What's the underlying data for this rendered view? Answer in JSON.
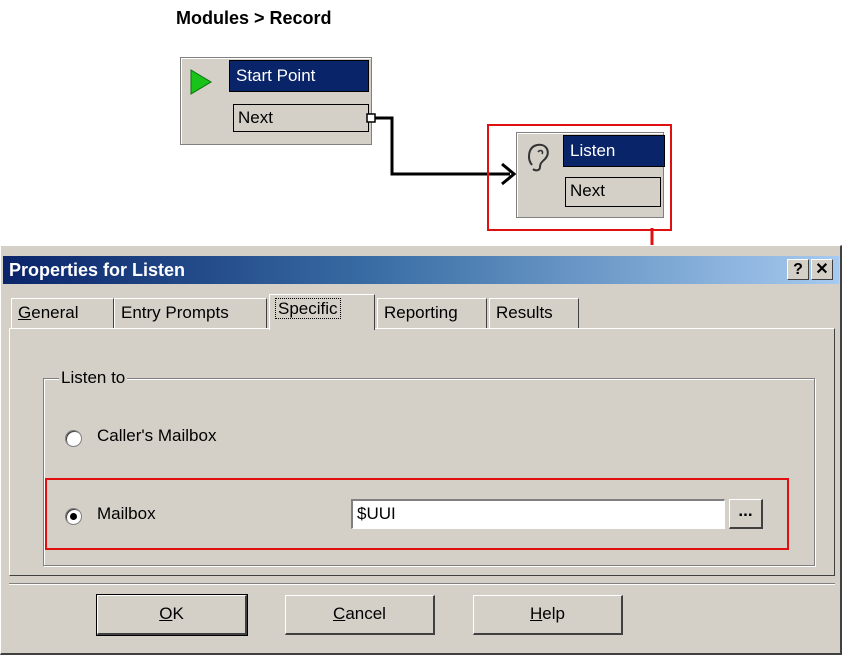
{
  "breadcrumb": "Modules > Record",
  "flow": {
    "start": {
      "title": "Start Point",
      "port": "Next"
    },
    "listen": {
      "title": "Listen",
      "port": "Next"
    }
  },
  "dialog": {
    "title": "Properties for Listen",
    "help_button": "?",
    "close_button": "✕",
    "tabs": [
      {
        "label": "General",
        "underline": "G",
        "rest": "eneral"
      },
      {
        "label": "Entry Prompts"
      },
      {
        "label": "Specific"
      },
      {
        "label": "Reporting"
      },
      {
        "label": "Results"
      }
    ],
    "active_tab": "Specific",
    "group_label": "Listen to",
    "radio_callers_mailbox": "Caller's Mailbox",
    "radio_mailbox": "Mailbox",
    "selected_radio": "Mailbox",
    "mailbox_value": "$UUI",
    "browse_button": "...",
    "ok": {
      "u": "O",
      "rest": "K"
    },
    "cancel": {
      "u": "C",
      "rest": "ancel"
    },
    "help": {
      "u": "H",
      "rest": "elp"
    }
  },
  "colors": {
    "highlight_red": "#e01010",
    "title_blue": "#0a246a"
  }
}
